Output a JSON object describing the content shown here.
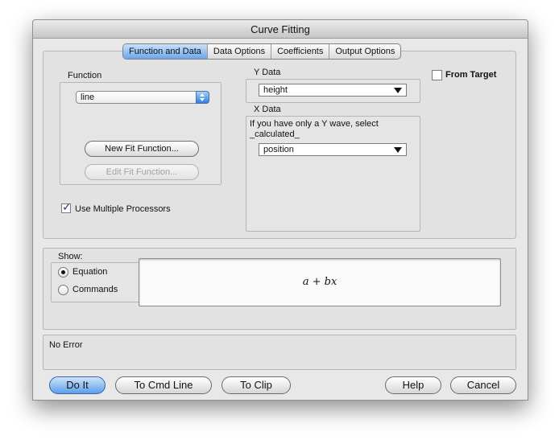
{
  "window": {
    "title": "Curve Fitting"
  },
  "tabs": [
    {
      "label": "Function and Data",
      "selected": true
    },
    {
      "label": "Data Options",
      "selected": false
    },
    {
      "label": "Coefficients",
      "selected": false
    },
    {
      "label": "Output Options",
      "selected": false
    }
  ],
  "function": {
    "label": "Function",
    "selected": "line",
    "new_button": "New Fit Function...",
    "edit_button": "Edit Fit Function..."
  },
  "multiproc": {
    "label": "Use Multiple Processors",
    "checked": true
  },
  "ydata": {
    "label": "Y Data",
    "selected": "height"
  },
  "xdata": {
    "label": "X Data",
    "hint": "If you have only a Y wave, select _calculated_",
    "selected": "position"
  },
  "from_target": {
    "label": "From Target",
    "checked": false
  },
  "show": {
    "label": "Show:",
    "options": [
      "Equation",
      "Commands"
    ],
    "selected": "Equation"
  },
  "equation": "a + bx",
  "status": "No Error",
  "buttons": {
    "do_it": "Do It",
    "to_cmd_line": "To Cmd Line",
    "to_clip": "To Clip",
    "help": "Help",
    "cancel": "Cancel"
  },
  "colors": {
    "accent": "#5d9de6",
    "window_bg": "#e8e8e8"
  }
}
